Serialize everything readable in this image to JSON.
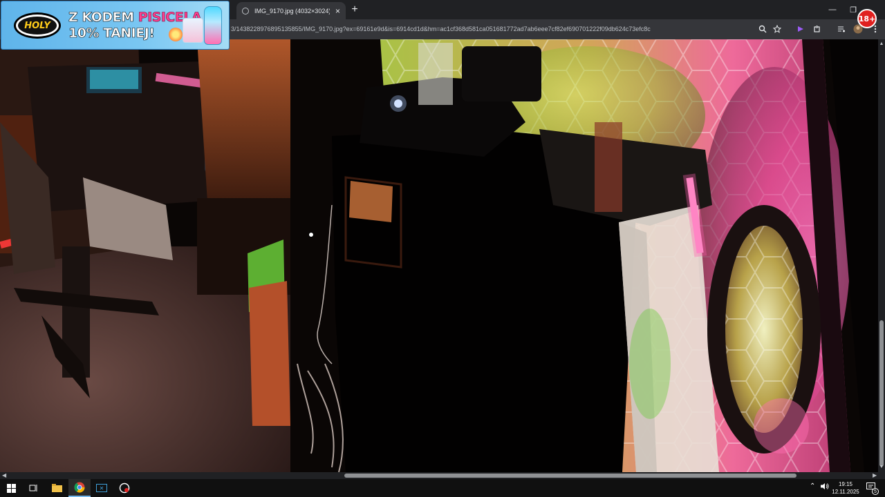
{
  "browser": {
    "tab_title": "IMG_9170.jpg (4032×3024)",
    "new_tab_label": "+",
    "url": "3/1438228976895135855/IMG_9170.jpg?ex=69161e9d&is=6914cd1d&hm=ac1cf368d581ca051681772ad7ab6eee7cf82ef690701222f09db624c73efc8c",
    "minimize_glyph": "—",
    "restore_glyph": "❐",
    "close_glyph": "✕",
    "tab_close_glyph": "×"
  },
  "ad": {
    "logo_text": "HOLY",
    "line1_prefix": "Z KODEM ",
    "line1_code": "PISICELA",
    "line2": "10% TANIEJ!"
  },
  "badge": {
    "label": "18+",
    "color": "#e0201f"
  },
  "taskbar": {
    "time": "19:15",
    "date": "12.11.2025",
    "notification_count": "5"
  },
  "icons": [
    "search-icon",
    "star-icon",
    "extension-icon",
    "puzzle-icon",
    "media-icon",
    "profile-avatar",
    "menu-icon",
    "windows-start-icon",
    "task-view-icon",
    "file-explorer-icon",
    "chrome-icon",
    "excel-icon",
    "app-icon",
    "chevron-up-icon",
    "volume-icon",
    "notification-icon"
  ],
  "colors": {
    "chrome_dark": "#202124",
    "chrome_toolbar": "#35363a",
    "taskbar": "#101010",
    "ad_blue": "#79c6f2",
    "ad_pink": "#ff3f8e"
  }
}
